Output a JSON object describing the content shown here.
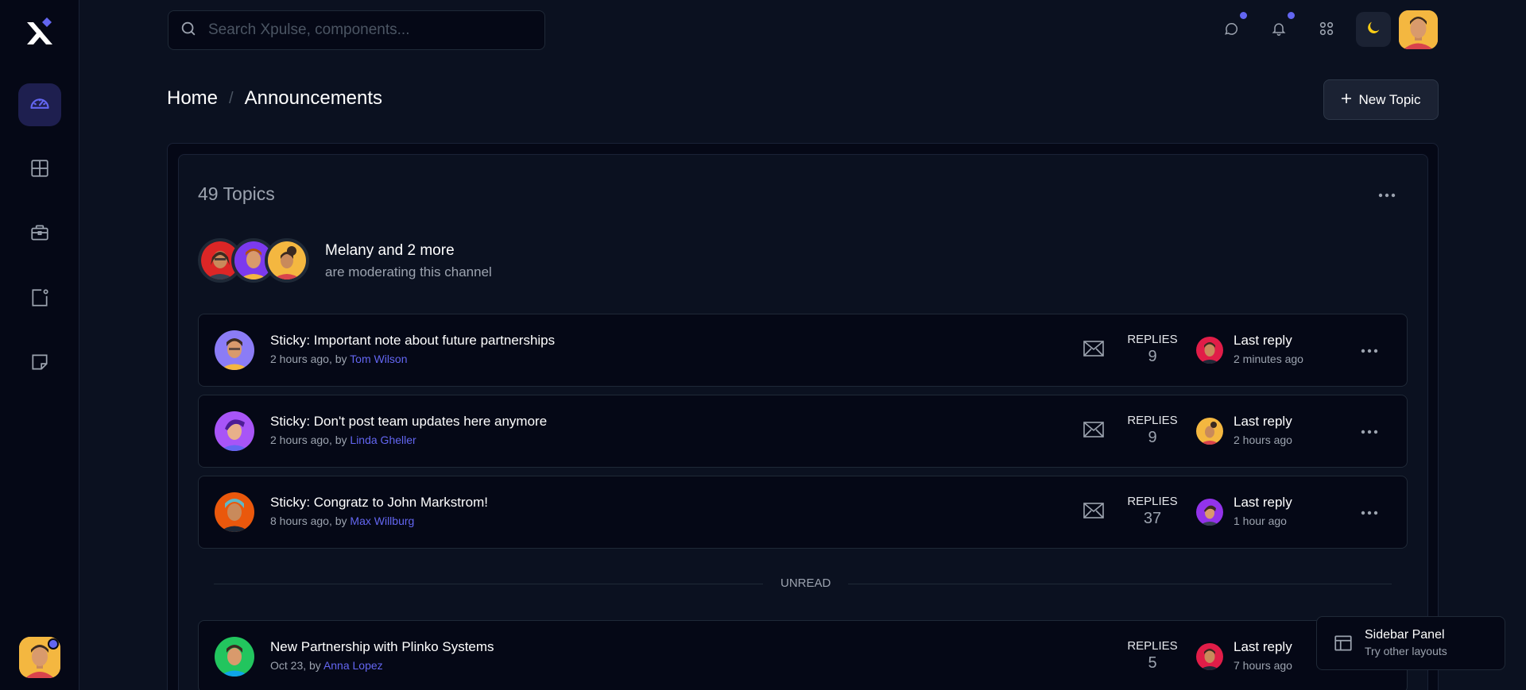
{
  "search": {
    "placeholder": "Search Xpulse, components..."
  },
  "breadcrumb": {
    "home": "Home",
    "separator": "/",
    "current": "Announcements"
  },
  "actions": {
    "new_topic": "New Topic"
  },
  "forum": {
    "topics_count": "49 Topics",
    "moderators_title": "Melany and 2 more",
    "moderators_subtitle": "are moderating this channel"
  },
  "sticky_topics": [
    {
      "title": "Sticky: Important note about future partnerships",
      "meta": "2 hours ago, by ",
      "author": "Tom Wilson",
      "replies_label": "REPLIES",
      "replies": "9",
      "last_reply_label": "Last reply",
      "last_reply_time": "2 minutes ago"
    },
    {
      "title": "Sticky: Don't post team updates here anymore",
      "meta": "2 hours ago, by ",
      "author": "Linda Gheller",
      "replies_label": "REPLIES",
      "replies": "9",
      "last_reply_label": "Last reply",
      "last_reply_time": "2 hours ago"
    },
    {
      "title": "Sticky: Congratz to John Markstrom!",
      "meta": "8 hours ago, by ",
      "author": "Max Willburg",
      "replies_label": "REPLIES",
      "replies": "37",
      "last_reply_label": "Last reply",
      "last_reply_time": "1 hour ago"
    }
  ],
  "unread_label": "UNREAD",
  "unread_topics": [
    {
      "title": "New Partnership with Plinko Systems",
      "meta": "Oct 23, by ",
      "author": "Anna Lopez",
      "replies_label": "REPLIES",
      "replies": "5",
      "last_reply_label": "Last reply",
      "last_reply_time": "7 hours ago"
    }
  ],
  "layout_switcher": {
    "title": "Sidebar Panel",
    "subtitle": "Try other layouts"
  },
  "colors": {
    "accent": "#6366f1",
    "background": "#0b1120",
    "surface": "#050816",
    "avatar_yellow": "#f4b740"
  },
  "icons": {
    "sidebar": [
      "dashboard-gauge-icon",
      "grid-icon",
      "briefcase-icon",
      "notes-icon",
      "sticky-note-icon"
    ],
    "topbar": [
      "chat-icon",
      "bell-icon",
      "apps-grid-icon",
      "moon-icon"
    ]
  }
}
